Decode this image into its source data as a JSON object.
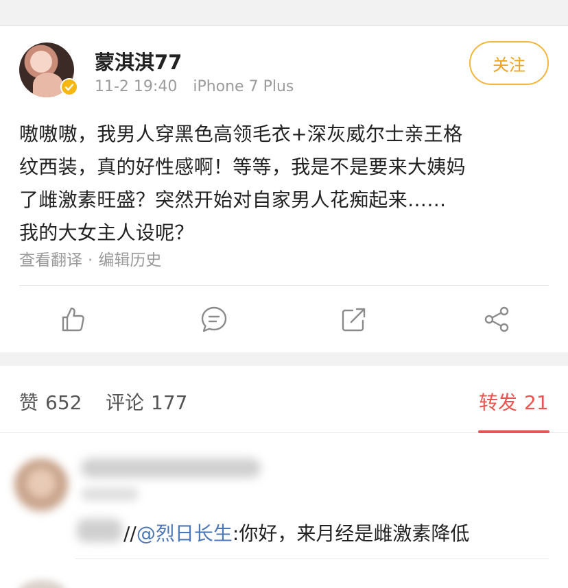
{
  "post": {
    "username": "蒙淇淇77",
    "time": "11-2 19:40",
    "device": "iPhone 7 Plus",
    "follow_label": "关注",
    "content_lines": [
      "嗷嗷嗷，我男人穿黑色高领毛衣+深灰威尔士亲王格",
      "纹西装，真的好性感啊！等等，我是不是要来大姨妈",
      "了雌激素旺盛？突然开始对自家男人花痴起来……",
      "我的大女主人设呢？"
    ],
    "translate_label": "查看翻译",
    "separator": "·",
    "edit_history_label": "编辑历史"
  },
  "actions": [
    {
      "name": "like-icon"
    },
    {
      "name": "comment-icon"
    },
    {
      "name": "repost-icon"
    },
    {
      "name": "share-icon"
    }
  ],
  "tabs": {
    "likes": {
      "label": "赞",
      "count": "652"
    },
    "comments": {
      "label": "评论",
      "count": "177"
    },
    "reposts": {
      "label": "转发",
      "count": "21"
    }
  },
  "repost": {
    "prefix": "//",
    "mention": "@烈日长生",
    "text": ":你好，来月经是雌激素降低"
  },
  "colors": {
    "accent_red": "#e8544f",
    "follow_orange": "#f0a21a",
    "mention_blue": "#4b77b7",
    "verified_gold": "#f6b712"
  }
}
